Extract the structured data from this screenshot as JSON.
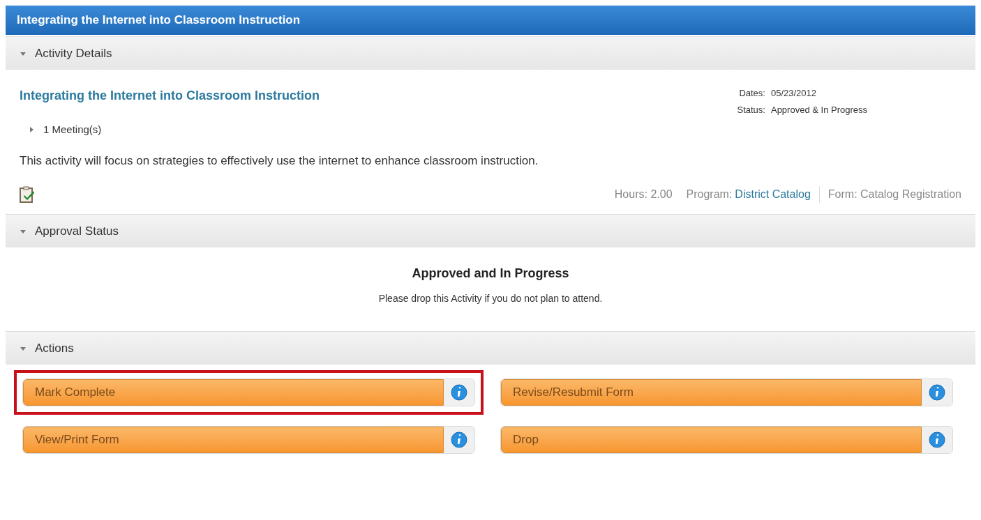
{
  "window": {
    "title": "Integrating the Internet into Classroom Instruction"
  },
  "activity_details": {
    "heading": "Activity Details",
    "expanded": true,
    "title": "Integrating the Internet into Classroom Instruction",
    "fields": [
      {
        "label": "Dates:",
        "value": "05/23/2012"
      },
      {
        "label": "Status:",
        "value": "Approved & In Progress"
      }
    ],
    "meetings": {
      "label": "1 Meeting(s)",
      "expanded": false
    },
    "description": "This activity will focus on strategies to effectively use the internet to enhance classroom instruction.",
    "hours": "Hours: 2.00",
    "program_label": "Program:",
    "program_link": "District Catalog",
    "form": "Form: Catalog Registration"
  },
  "approval_status": {
    "heading": "Approval Status",
    "expanded": true,
    "title": "Approved and In Progress",
    "note": "Please drop this Activity if you do not plan to attend."
  },
  "actions": {
    "heading": "Actions",
    "expanded": true,
    "buttons": [
      {
        "label": "Mark Complete",
        "highlighted": true
      },
      {
        "label": "Revise/Resubmit Form",
        "highlighted": false
      },
      {
        "label": "View/Print Form",
        "highlighted": false
      },
      {
        "label": "Drop",
        "highlighted": false
      }
    ]
  }
}
